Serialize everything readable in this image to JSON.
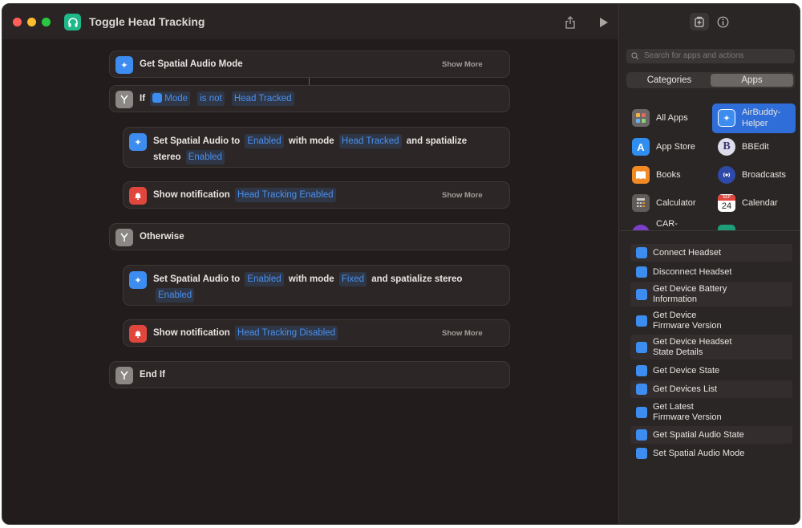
{
  "window": {
    "title": "Toggle Head Tracking"
  },
  "editor": {
    "get_mode": {
      "title": "Get Spatial Audio Mode",
      "show_more": "Show More"
    },
    "if_block": {
      "keyword": "If",
      "var": "Mode",
      "op": "is not",
      "value": "Head Tracked"
    },
    "set_audio_1": {
      "prefix": "Set Spatial Audio to",
      "state": "Enabled",
      "with_mode": "with mode",
      "mode": "Head Tracked",
      "spatialize": "and spatialize",
      "stereo": "stereo",
      "stereo_state": "Enabled"
    },
    "notify_1": {
      "prefix": "Show notification",
      "message": "Head Tracking Enabled",
      "show_more": "Show More"
    },
    "otherwise": {
      "title": "Otherwise"
    },
    "set_audio_2": {
      "prefix": "Set Spatial Audio to",
      "state": "Enabled",
      "with_mode": "with mode",
      "mode": "Fixed",
      "spatialize": "and spatialize stereo",
      "stereo_state": "Enabled"
    },
    "notify_2": {
      "prefix": "Show notification",
      "message": "Head Tracking Disabled",
      "show_more": "Show More"
    },
    "end_if": {
      "title": "End If"
    }
  },
  "sidebar": {
    "search_placeholder": "Search for apps and actions",
    "segments": {
      "categories": "Categories",
      "apps": "Apps",
      "selected": "Apps"
    },
    "apps": [
      {
        "name": "All Apps",
        "icon": "grid-icon"
      },
      {
        "name": "AirBuddy-Helper",
        "line1": "AirBuddy-",
        "line2": "Helper",
        "icon": "airbuddy-icon",
        "selected": true
      },
      {
        "name": "App Store",
        "icon": "app-store-icon"
      },
      {
        "name": "BBEdit",
        "icon": "bbedit-icon"
      },
      {
        "name": "Books",
        "icon": "books-icon"
      },
      {
        "name": "Broadcasts",
        "icon": "broadcasts-icon"
      },
      {
        "name": "Calculator",
        "icon": "calculator-icon"
      },
      {
        "name": "Calendar",
        "icon": "calendar-icon",
        "badge_month": "SEP",
        "badge_day": "24"
      },
      {
        "name": "CAR-",
        "icon": "car-icon"
      }
    ],
    "actions": [
      {
        "line1": "Connect Headset"
      },
      {
        "line1": "Disconnect Headset"
      },
      {
        "line1": "Get Device Battery",
        "line2": "Information"
      },
      {
        "line1": "Get Device",
        "line2": "Firmware Version"
      },
      {
        "line1": "Get Device Headset",
        "line2": "State Details"
      },
      {
        "line1": "Get Device State"
      },
      {
        "line1": "Get Devices List"
      },
      {
        "line1": "Get Latest",
        "line2": "Firmware Version"
      },
      {
        "line1": "Get Spatial Audio State"
      },
      {
        "line1": "Set Spatial Audio Mode"
      }
    ]
  },
  "colors": {
    "accent": "#3d8df0",
    "token_text": "#4a90f0",
    "window_bg": "#221d1c",
    "sidebar_bg": "#2a2625",
    "close": "#ff5f57",
    "minimize": "#febc2e",
    "zoom": "#28c840"
  }
}
